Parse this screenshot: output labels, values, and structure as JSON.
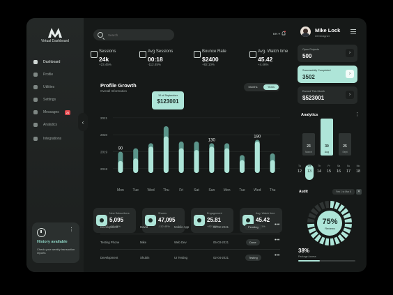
{
  "brand": {
    "name": "Virtual Dashboard"
  },
  "nav": [
    {
      "label": "Dashboard",
      "icon": "home-icon",
      "active": true
    },
    {
      "label": "Profile",
      "icon": "user-icon"
    },
    {
      "label": "Utilities",
      "icon": "box-icon"
    },
    {
      "label": "Settings",
      "icon": "gear-icon"
    },
    {
      "label": "Messages",
      "icon": "message-icon",
      "badge": "26"
    },
    {
      "label": "Analytics",
      "icon": "chart-icon"
    },
    {
      "label": "Integrations",
      "icon": "plug-icon"
    }
  ],
  "history": {
    "title": "History available",
    "desc": "Check your weekly transaction reports"
  },
  "search": {
    "placeholder": "Search"
  },
  "header": {
    "lang": "EN"
  },
  "stats": [
    {
      "label": "Sessions",
      "value": "24k",
      "change": "+23.45%",
      "icon": "alarm-icon"
    },
    {
      "label": "Avg Sessions",
      "value": "00:18",
      "change": "-112.45%",
      "icon": "monitor-icon"
    },
    {
      "label": "Bounce Rate",
      "value": "$2400",
      "change": "+82.10%",
      "icon": "bounce-icon"
    },
    {
      "label": "Avg. Watch time",
      "value": "45.42",
      "change": "+4.46%",
      "icon": "watch-icon"
    }
  ],
  "growth": {
    "title": "Profile Growth",
    "subtitle": "Overall Information",
    "toggle": [
      "Months",
      "Years"
    ],
    "tooltip": {
      "date": "10 of September",
      "value": "$123001"
    }
  },
  "chart_data": {
    "type": "bar",
    "categories": [
      "Mon",
      "Tue",
      "Wed",
      "Thu",
      "Fri",
      "Sat",
      "Sun",
      "Mon",
      "Tue",
      "Wed",
      "Thu"
    ],
    "ylabels": [
      "2021",
      "2020",
      "2019",
      "2018"
    ],
    "ylim": [
      2017.5,
      2021.2
    ],
    "series": [
      {
        "values": [
          2018.45,
          2018.6,
          2019.3,
          2019.9,
          2019.2,
          2019.1,
          2019.3,
          2019.2,
          2018.5,
          2019.6,
          2018.5
        ]
      },
      {
        "values": [
          2019.0,
          2019.2,
          2019.5,
          2020.5,
          2019.6,
          2019.6,
          2019.5,
          2019.5,
          2018.8,
          2019.7,
          2018.9
        ]
      }
    ],
    "labels": [
      {
        "index": 0,
        "text": "90"
      },
      {
        "index": 6,
        "text": "130"
      },
      {
        "index": 9,
        "text": "190"
      }
    ],
    "colors": {
      "accent": "#aee5d8",
      "teal": "#5b958a"
    }
  },
  "cards": [
    {
      "label": "New Subscribers",
      "value": "5,095",
      "change": "+23.45%"
    },
    {
      "label": "Shares",
      "value": "47,095",
      "change": "-112.45%"
    },
    {
      "label": "Engagement",
      "value": "25.81",
      "change": "+82.10%"
    },
    {
      "label": "Avg. Watch time",
      "value": "45.42",
      "change": "+4.46%"
    }
  ],
  "table": [
    {
      "c1": "Development",
      "c2": "David",
      "c3": "Mobile App",
      "c4": "02-02-2021",
      "status": "Pending"
    },
    {
      "c1": "Testing Phone",
      "c2": "Mike",
      "c3": "Web Dev",
      "c4": "05-03-2021",
      "status": "Done"
    },
    {
      "c1": "Development",
      "c2": "Shubin",
      "c3": "UI Testing",
      "c4": "02-04-2021",
      "status": "Testing"
    }
  ],
  "profile": {
    "name": "Mike Lock",
    "role": "UI Designer"
  },
  "rcards": [
    {
      "label": "Open Projects",
      "value": "500"
    },
    {
      "label": "Successfully Completed",
      "value": "3502",
      "highlight": true
    },
    {
      "label": "Earned This Month",
      "value": "$523001"
    }
  ],
  "analytics": {
    "title": "Analytics",
    "bars": [
      {
        "value": "23",
        "label": "March"
      },
      {
        "value": "30",
        "label": "Aug",
        "on": true
      },
      {
        "value": "25",
        "label": "Sept"
      }
    ]
  },
  "calendar": [
    {
      "d": "Tu",
      "n": "12"
    },
    {
      "d": "We",
      "n": "13",
      "sel": true
    },
    {
      "d": "Th",
      "n": "14"
    },
    {
      "d": "Fr",
      "n": "15"
    },
    {
      "d": "Sa",
      "n": "16"
    },
    {
      "d": "Su",
      "n": "17"
    },
    {
      "d": "Mo",
      "n": "18"
    }
  ],
  "audit": {
    "title": "Audit",
    "chip": "Feb 1 to Mar 8",
    "x": "✕",
    "donut_value": "75%",
    "donut_label": "Reviews",
    "donut_fraction": 0.75
  },
  "progress": {
    "value": "38%",
    "label": "Package Access",
    "fraction": 0.38
  }
}
